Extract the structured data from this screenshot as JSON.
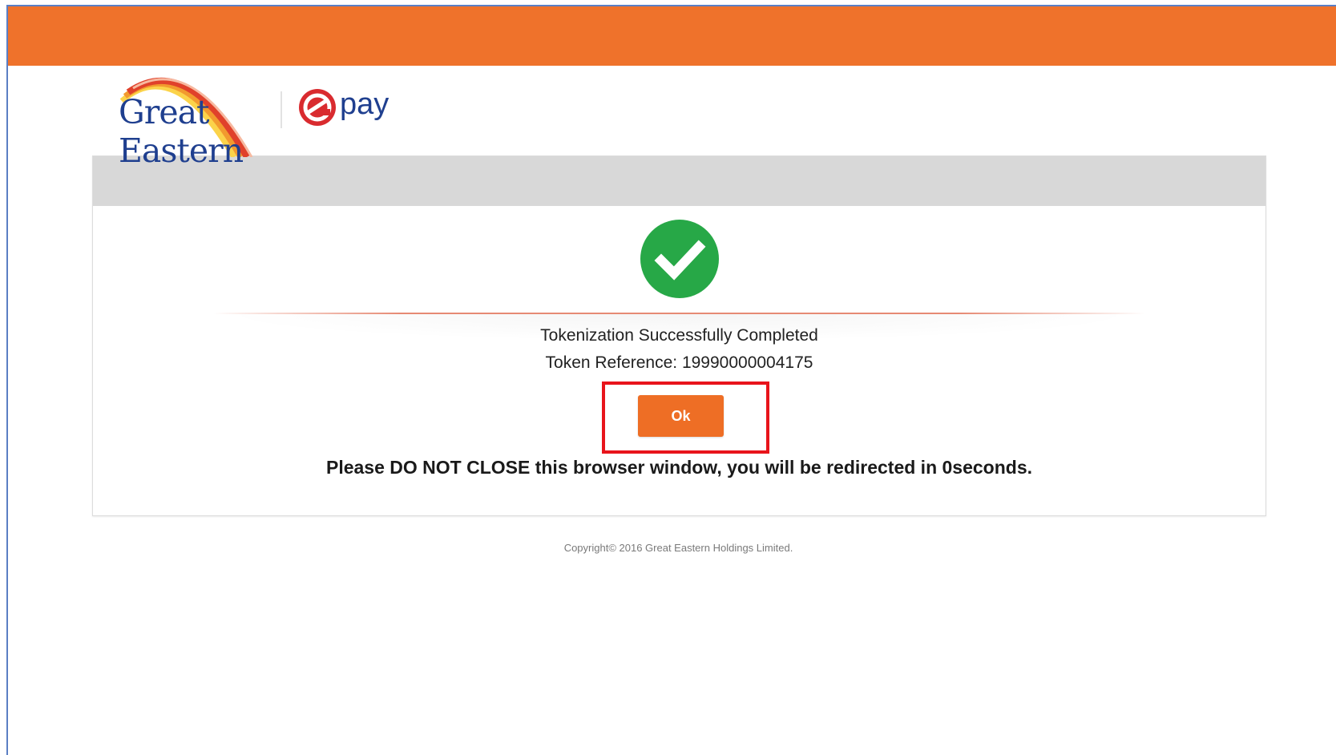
{
  "brand": {
    "logo_line1": "Great",
    "logo_line2": "Eastern",
    "epay_label": "pay"
  },
  "colors": {
    "top_bar": "#ef722b",
    "primary_blue": "#1f3f8f",
    "success_green": "#27a847",
    "button_orange": "#ee6e25",
    "highlight_red": "#e8141b",
    "card_header_gray": "#d8d8d8"
  },
  "icons": {
    "status": "check-circle-icon",
    "epay": "epay-e-icon"
  },
  "result": {
    "title": "Tokenization Successfully Completed",
    "token_reference": "Token Reference: 19990000004175"
  },
  "actions": {
    "ok_label": "Ok"
  },
  "notice": {
    "redirect": "Please DO NOT CLOSE this browser window, you will be redirected in 0seconds."
  },
  "footer": {
    "copyright": "Copyright© 2016 Great Eastern Holdings Limited."
  }
}
